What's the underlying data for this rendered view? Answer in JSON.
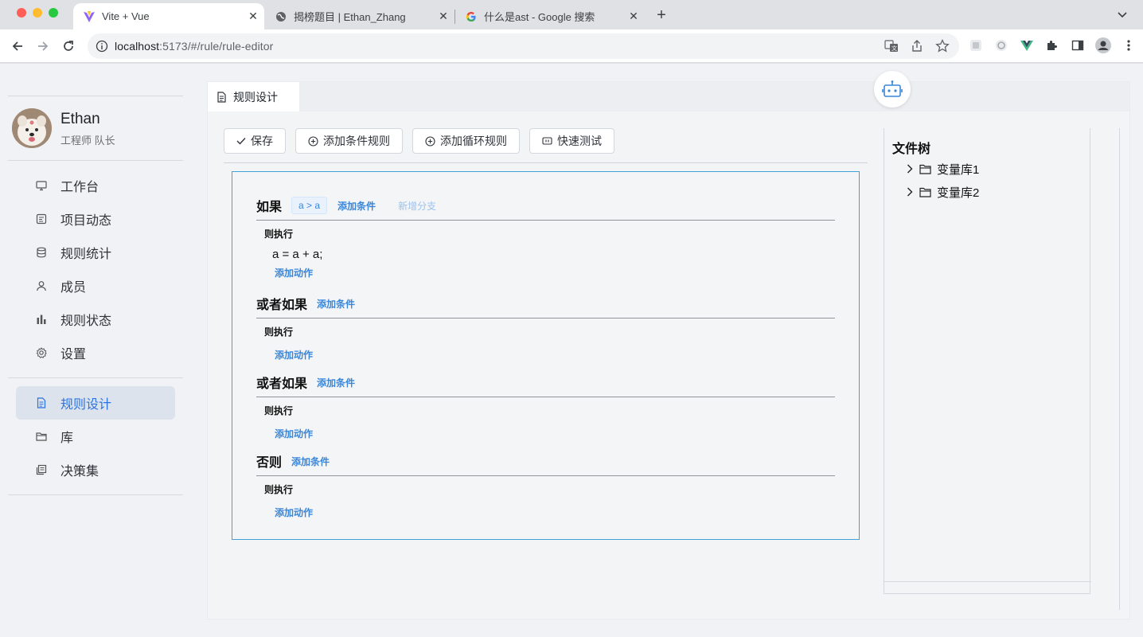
{
  "browser": {
    "tabs": [
      {
        "title": "Vite + Vue",
        "icon": "vite-icon"
      },
      {
        "title": "揭榜题目 | Ethan_Zhang",
        "icon": "globe-icon"
      },
      {
        "title": "什么是ast - Google 搜索",
        "icon": "google-icon"
      }
    ],
    "url_host": "localhost",
    "url_path": ":5173/#/rule/rule-editor"
  },
  "profile": {
    "name": "Ethan",
    "role": "工程师 队长"
  },
  "sidebar": {
    "items": [
      {
        "label": "工作台",
        "icon": "monitor-icon"
      },
      {
        "label": "项目动态",
        "icon": "activity-icon"
      },
      {
        "label": "规则统计",
        "icon": "database-icon"
      },
      {
        "label": "成员",
        "icon": "user-icon"
      },
      {
        "label": "规则状态",
        "icon": "bar-chart-icon"
      },
      {
        "label": "设置",
        "icon": "gear-icon"
      }
    ],
    "items2": [
      {
        "label": "规则设计",
        "icon": "document-icon",
        "active": true
      },
      {
        "label": "库",
        "icon": "folder-icon"
      },
      {
        "label": "决策集",
        "icon": "copy-icon"
      }
    ]
  },
  "page_tab": {
    "label": "规则设计"
  },
  "toolbar": {
    "save": "保存",
    "add_condition_rule": "添加条件规则",
    "add_loop_rule": "添加循环规则",
    "quick_test": "快速测试"
  },
  "editor": {
    "if_block": {
      "keyword": "如果",
      "condition": "a > a",
      "add_condition": "添加条件",
      "add_branch": "新增分支",
      "then": "则执行",
      "action": "a = a + a;",
      "add_action": "添加动作"
    },
    "elif_blocks": [
      {
        "keyword": "或者如果",
        "add_condition": "添加条件",
        "then": "则执行",
        "add_action": "添加动作"
      },
      {
        "keyword": "或者如果",
        "add_condition": "添加条件",
        "then": "则执行",
        "add_action": "添加动作"
      }
    ],
    "else_block": {
      "keyword": "否则",
      "add_condition": "添加条件",
      "then": "则执行",
      "add_action": "添加动作"
    }
  },
  "file_tree": {
    "title": "文件树",
    "nodes": [
      "变量库1",
      "变量库2"
    ]
  },
  "colors": {
    "accent": "#2a73e0",
    "link": "#3a86d8",
    "editor_border": "#3fa3d8"
  }
}
